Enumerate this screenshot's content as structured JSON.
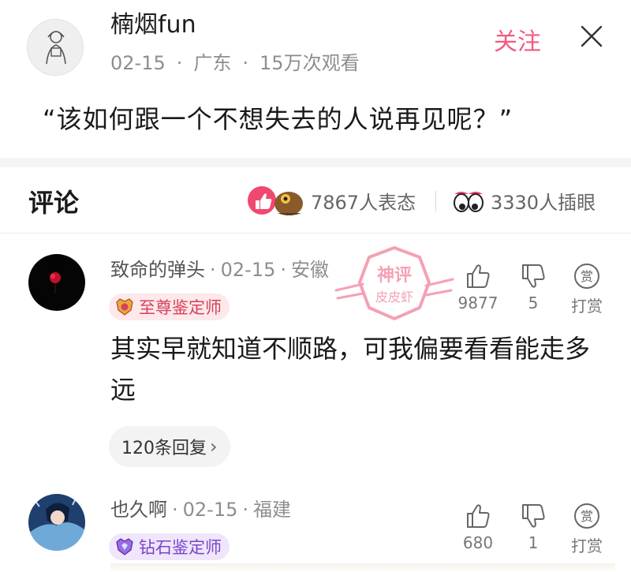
{
  "post": {
    "author_name": "楠烟fun",
    "date": "02-15",
    "location": "广东",
    "views": "15万次观看",
    "follow_label": "关注",
    "title": "“该如何跟一个不想失去的人说再见呢？”"
  },
  "comments_header": {
    "title": "评论",
    "reactions_count": "7867人表态",
    "eyes_count": "3330人插眼"
  },
  "comments": [
    {
      "username": "致命的弹头",
      "date": "02-15",
      "location": "安徽",
      "badge": "至尊鉴定师",
      "text": "其实早就知道不顺路，可我偏要看看能走多远",
      "likes": "9877",
      "dislikes": "5",
      "tip_label": "打赏",
      "tip_icon_char": "赏",
      "replies_label": "120条回复"
    },
    {
      "username": "也久啊",
      "date": "02-15",
      "location": "福建",
      "badge": "钻石鉴定师",
      "likes": "680",
      "dislikes": "1",
      "tip_label": "打赏",
      "tip_icon_char": "赏"
    }
  ],
  "stamp": {
    "top_text": "神评",
    "bottom_text": "皮皮虾"
  },
  "colors": {
    "accent_pink": "#f25a80",
    "gold_badge_text": "#d5425d",
    "diamond_badge_text": "#7a46c9",
    "muted_text": "#8e8e8e"
  },
  "icons": {
    "close": "close-icon",
    "like": "thumbs-up-icon",
    "dislike": "thumbs-down-icon",
    "tip": "tip-coin-icon",
    "reactions": "reaction-emoji-icon",
    "eyes": "eyes-emoji-icon"
  }
}
